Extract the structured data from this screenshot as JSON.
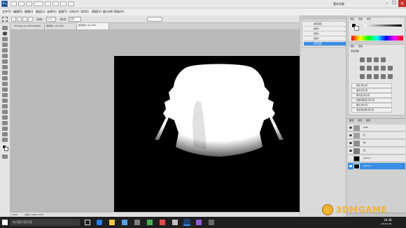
{
  "app": {
    "logo": "Ps",
    "menu": [
      "文件(F)",
      "编辑(E)",
      "图像(I)",
      "图层(L)",
      "选择(S)",
      "滤镜(T)",
      "分析(A)",
      "3D(D)",
      "视图(V)",
      "窗口(W)",
      "帮助(H)"
    ],
    "zoom": "100%",
    "workspace": "基本功能",
    "options": {
      "feather_label": "羽化:",
      "feather_value": "0 px",
      "style_label": "样式:",
      "style_value": "正常"
    }
  },
  "document": {
    "tabs": [
      "8030.jpg @ 100%(RGB/8)",
      "未标题-1 @ 100%",
      "未标题-2 @ 100%"
    ],
    "active_tab": 2,
    "status_zoom": "100%",
    "status_doc": "文档:1.03M/7.55M"
  },
  "channels_panel": {
    "items": [
      "通道选区",
      "通道1",
      "通道2",
      "通道3",
      "通道选区"
    ],
    "selected": 4
  },
  "color_panel": {
    "tabs": [
      "颜色",
      "色板",
      "样式"
    ],
    "swatch_colors": [
      "#e53935",
      "#fb8c00",
      "#fdd835",
      "#43a047",
      "#00acc1",
      "#1e88e5",
      "#8e24aa",
      "#d81b60",
      "#6d4c41",
      "#757575",
      "#000000",
      "#ffffff"
    ]
  },
  "adjustments_panel": {
    "tabs": [
      "调整",
      "蒙版"
    ],
    "header": "添加调整",
    "presets": [
      "色阶 默认值",
      "曲线 默认值",
      "曝光度 默认值",
      "色相/饱和度 默认值",
      "黑白 默认值",
      "通道混合器 默认值",
      "可选颜色 默认值"
    ]
  },
  "layers_panel": {
    "tabs": [
      "图层",
      "通道",
      "路径"
    ],
    "items": [
      "RGB",
      "红",
      "绿",
      "蓝",
      "Alpha 1",
      "Alpha 2"
    ],
    "selected": 5
  },
  "watermark": {
    "text": "3DMGAME"
  },
  "taskbar": {
    "search_placeholder": "有问题尽管问我",
    "time": "18:38",
    "date": "2016/1/26"
  },
  "colors": {
    "accent": "#3a8ee6",
    "canvas": "#000000",
    "taskbar": "#1f1f1f"
  }
}
